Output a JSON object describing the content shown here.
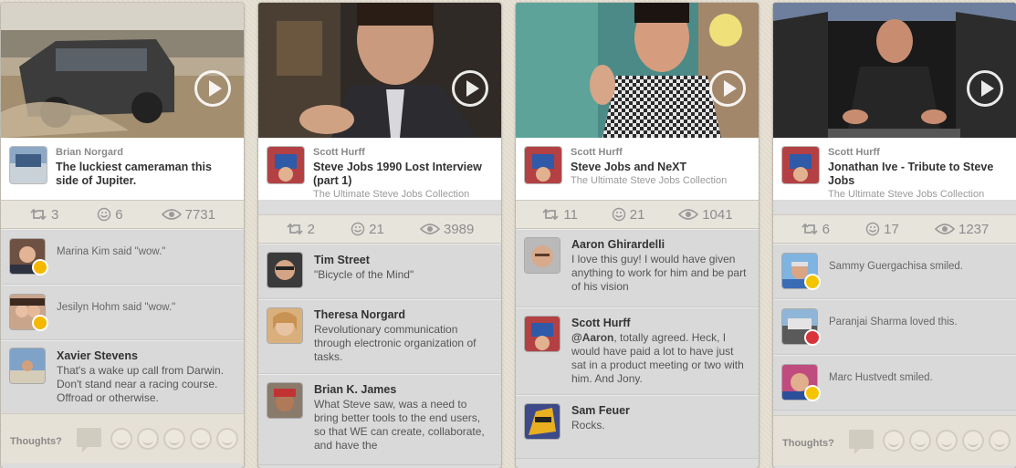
{
  "cards": [
    {
      "author": "Brian Norgard",
      "title": "The luckiest cameraman this side of Jupiter.",
      "collection": "",
      "stats": {
        "reposts": "3",
        "reactions": "6",
        "views": "7731"
      },
      "comments": [
        {
          "text": "Marina Kim said \"wow.\""
        },
        {
          "text": "Jesilyn Hohm said \"wow.\""
        },
        {
          "name": "Xavier Stevens",
          "text": "That's a wake up call from Darwin. Don't stand near a racing course. Offroad or otherwise."
        }
      ],
      "footer_label": "Thoughts?"
    },
    {
      "author": "Scott Hurff",
      "title": "Steve Jobs 1990 Lost Interview (part 1)",
      "collection": "The Ultimate Steve Jobs Collection",
      "stats": {
        "reposts": "2",
        "reactions": "21",
        "views": "3989"
      },
      "comments": [
        {
          "name": "Tim Street",
          "text": "\"Bicycle of the Mind\""
        },
        {
          "name": "Theresa Norgard",
          "text": "Revolutionary communication through electronic organization of tasks."
        },
        {
          "name": "Brian K. James",
          "text": "What Steve saw, was a need to bring better tools to the end users, so that WE can create, collaborate, and have the"
        }
      ]
    },
    {
      "author": "Scott Hurff",
      "title": "Steve Jobs and NeXT",
      "collection": "The Ultimate Steve Jobs Collection",
      "stats": {
        "reposts": "11",
        "reactions": "21",
        "views": "1041"
      },
      "comments": [
        {
          "name": "Aaron Ghirardelli",
          "text": "I love this guy! I would have given anything to work for him and be part of his vision"
        },
        {
          "name": "Scott Hurff",
          "mention": "@Aaron",
          "text": ", totally agreed. Heck, I would have paid a lot to have just sat in a product meeting or two with him. And Jony."
        },
        {
          "name": "Sam Feuer",
          "text": "Rocks."
        }
      ]
    },
    {
      "author": "Scott Hurff",
      "title": "Jonathan Ive - Tribute to Steve Jobs",
      "collection": "The Ultimate Steve Jobs Collection",
      "stats": {
        "reposts": "6",
        "reactions": "17",
        "views": "1237"
      },
      "comments": [
        {
          "text": "Sammy Guergachisa smiled."
        },
        {
          "text": "Paranjai Sharma loved this."
        },
        {
          "text": "Marc Hustvedt smiled."
        }
      ],
      "footer_label": "Thoughts?"
    }
  ],
  "colors": {
    "background": "#e6dfd2",
    "badge_wow": "#f5b700",
    "badge_love": "#d9343a",
    "badge_smile": "#f5c400"
  }
}
